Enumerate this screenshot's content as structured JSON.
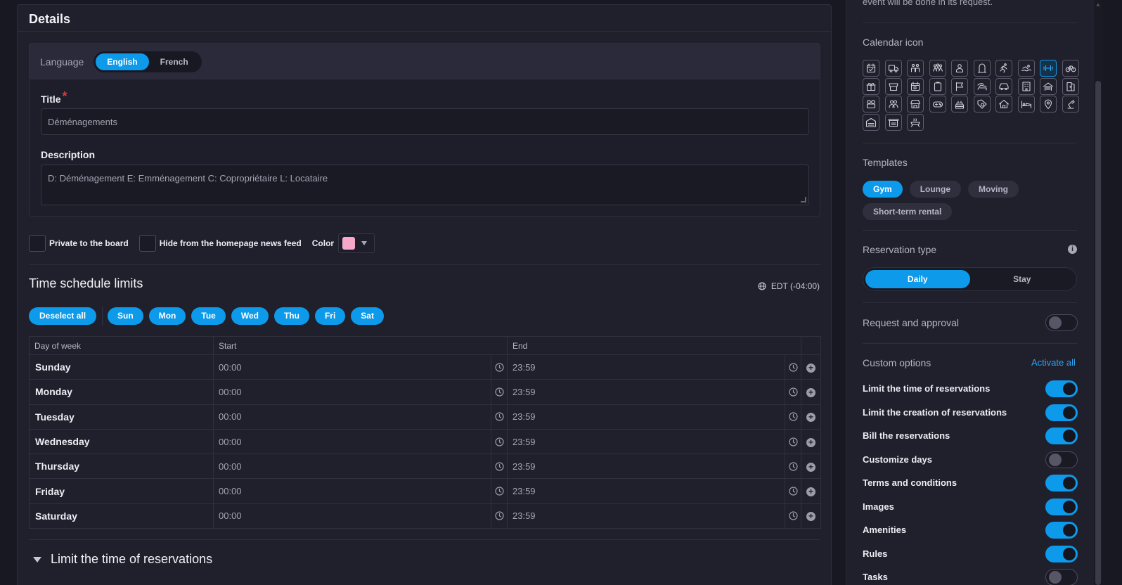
{
  "details": {
    "title": "Details",
    "language": {
      "label": "Language",
      "options": [
        "English",
        "French"
      ],
      "active": "English"
    },
    "title_field": {
      "label": "Title",
      "required_mark": "*",
      "value": "Déménagements"
    },
    "description_field": {
      "label": "Description",
      "value": "D: Déménagement  E: Emménagement  C: Copropriétaire  L: Locataire"
    },
    "private_label": "Private to the board",
    "hide_label": "Hide from the homepage news feed",
    "color_label": "Color",
    "color_value": "#f7a8c9"
  },
  "schedule": {
    "title": "Time schedule limits",
    "timezone": "EDT (-04:00)",
    "deselect_label": "Deselect all",
    "days": [
      "Sun",
      "Mon",
      "Tue",
      "Wed",
      "Thu",
      "Fri",
      "Sat"
    ],
    "headers": [
      "Day of week",
      "Start",
      "End"
    ],
    "rows": [
      {
        "day": "Sunday",
        "start": "00:00",
        "end": "23:59"
      },
      {
        "day": "Monday",
        "start": "00:00",
        "end": "23:59"
      },
      {
        "day": "Tuesday",
        "start": "00:00",
        "end": "23:59"
      },
      {
        "day": "Wednesday",
        "start": "00:00",
        "end": "23:59"
      },
      {
        "day": "Thursday",
        "start": "00:00",
        "end": "23:59"
      },
      {
        "day": "Friday",
        "start": "00:00",
        "end": "23:59"
      },
      {
        "day": "Saturday",
        "start": "00:00",
        "end": "23:59"
      }
    ],
    "collapse_title": "Limit the time of reservations"
  },
  "sidebar": {
    "cutoff_text": "event will be done in its request.",
    "calendar_icon_label": "Calendar icon",
    "icons": [
      "calendar-check-icon",
      "truck-icon",
      "family-icon",
      "group-icon",
      "concierge-icon",
      "tombstone-icon",
      "running-icon",
      "swimming-icon",
      "dumbbell-icon",
      "bicycle-icon",
      "gift-icon",
      "awning-icon",
      "calendar-event-icon",
      "clipboard-icon",
      "flag-icon",
      "lounge-chair-icon",
      "car-icon",
      "building-icon",
      "garage-icon",
      "door-icon",
      "theater-icon",
      "people-icon",
      "shop-icon",
      "gamepad-icon",
      "cake-icon",
      "laundry-icon",
      "house-icon",
      "bed-icon",
      "location-pin-icon",
      "desk-lamp-icon",
      "parking-icon",
      "storage-icon",
      "bbq-icon"
    ],
    "active_icon": "dumbbell-icon",
    "templates_label": "Templates",
    "templates": [
      "Gym",
      "Lounge",
      "Moving",
      "Short-term rental"
    ],
    "active_template": "Gym",
    "reservation_type_label": "Reservation type",
    "reservation_types": [
      "Daily",
      "Stay"
    ],
    "active_reservation_type": "Daily",
    "request_approval_label": "Request and approval",
    "request_approval_on": false,
    "custom_options_label": "Custom options",
    "activate_all_label": "Activate all",
    "custom_options": [
      {
        "label": "Limit the time of reservations",
        "on": true
      },
      {
        "label": "Limit the creation of reservations",
        "on": true
      },
      {
        "label": "Bill the reservations",
        "on": true
      },
      {
        "label": "Customize days",
        "on": false
      },
      {
        "label": "Terms and conditions",
        "on": true
      },
      {
        "label": "Images",
        "on": true
      },
      {
        "label": "Amenities",
        "on": true
      },
      {
        "label": "Rules",
        "on": true
      },
      {
        "label": "Tasks",
        "on": false
      }
    ]
  },
  "colors": {
    "accent": "#0d9aea",
    "background": "#181822",
    "panel": "#20202c",
    "required": "#e23a3a"
  }
}
